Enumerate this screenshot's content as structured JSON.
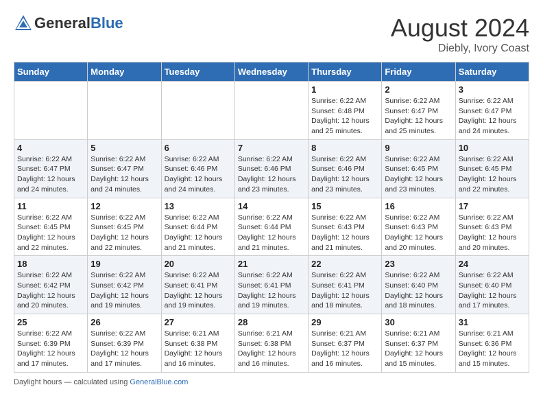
{
  "header": {
    "logo_general": "General",
    "logo_blue": "Blue",
    "month_year": "August 2024",
    "location": "Diebly, Ivory Coast"
  },
  "days_of_week": [
    "Sunday",
    "Monday",
    "Tuesday",
    "Wednesday",
    "Thursday",
    "Friday",
    "Saturday"
  ],
  "weeks": [
    [
      {
        "day": "",
        "info": ""
      },
      {
        "day": "",
        "info": ""
      },
      {
        "day": "",
        "info": ""
      },
      {
        "day": "",
        "info": ""
      },
      {
        "day": "1",
        "info": "Sunrise: 6:22 AM\nSunset: 6:48 PM\nDaylight: 12 hours\nand 25 minutes."
      },
      {
        "day": "2",
        "info": "Sunrise: 6:22 AM\nSunset: 6:47 PM\nDaylight: 12 hours\nand 25 minutes."
      },
      {
        "day": "3",
        "info": "Sunrise: 6:22 AM\nSunset: 6:47 PM\nDaylight: 12 hours\nand 24 minutes."
      }
    ],
    [
      {
        "day": "4",
        "info": "Sunrise: 6:22 AM\nSunset: 6:47 PM\nDaylight: 12 hours\nand 24 minutes."
      },
      {
        "day": "5",
        "info": "Sunrise: 6:22 AM\nSunset: 6:47 PM\nDaylight: 12 hours\nand 24 minutes."
      },
      {
        "day": "6",
        "info": "Sunrise: 6:22 AM\nSunset: 6:46 PM\nDaylight: 12 hours\nand 24 minutes."
      },
      {
        "day": "7",
        "info": "Sunrise: 6:22 AM\nSunset: 6:46 PM\nDaylight: 12 hours\nand 23 minutes."
      },
      {
        "day": "8",
        "info": "Sunrise: 6:22 AM\nSunset: 6:46 PM\nDaylight: 12 hours\nand 23 minutes."
      },
      {
        "day": "9",
        "info": "Sunrise: 6:22 AM\nSunset: 6:45 PM\nDaylight: 12 hours\nand 23 minutes."
      },
      {
        "day": "10",
        "info": "Sunrise: 6:22 AM\nSunset: 6:45 PM\nDaylight: 12 hours\nand 22 minutes."
      }
    ],
    [
      {
        "day": "11",
        "info": "Sunrise: 6:22 AM\nSunset: 6:45 PM\nDaylight: 12 hours\nand 22 minutes."
      },
      {
        "day": "12",
        "info": "Sunrise: 6:22 AM\nSunset: 6:45 PM\nDaylight: 12 hours\nand 22 minutes."
      },
      {
        "day": "13",
        "info": "Sunrise: 6:22 AM\nSunset: 6:44 PM\nDaylight: 12 hours\nand 21 minutes."
      },
      {
        "day": "14",
        "info": "Sunrise: 6:22 AM\nSunset: 6:44 PM\nDaylight: 12 hours\nand 21 minutes."
      },
      {
        "day": "15",
        "info": "Sunrise: 6:22 AM\nSunset: 6:43 PM\nDaylight: 12 hours\nand 21 minutes."
      },
      {
        "day": "16",
        "info": "Sunrise: 6:22 AM\nSunset: 6:43 PM\nDaylight: 12 hours\nand 20 minutes."
      },
      {
        "day": "17",
        "info": "Sunrise: 6:22 AM\nSunset: 6:43 PM\nDaylight: 12 hours\nand 20 minutes."
      }
    ],
    [
      {
        "day": "18",
        "info": "Sunrise: 6:22 AM\nSunset: 6:42 PM\nDaylight: 12 hours\nand 20 minutes."
      },
      {
        "day": "19",
        "info": "Sunrise: 6:22 AM\nSunset: 6:42 PM\nDaylight: 12 hours\nand 19 minutes."
      },
      {
        "day": "20",
        "info": "Sunrise: 6:22 AM\nSunset: 6:41 PM\nDaylight: 12 hours\nand 19 minutes."
      },
      {
        "day": "21",
        "info": "Sunrise: 6:22 AM\nSunset: 6:41 PM\nDaylight: 12 hours\nand 19 minutes."
      },
      {
        "day": "22",
        "info": "Sunrise: 6:22 AM\nSunset: 6:41 PM\nDaylight: 12 hours\nand 18 minutes."
      },
      {
        "day": "23",
        "info": "Sunrise: 6:22 AM\nSunset: 6:40 PM\nDaylight: 12 hours\nand 18 minutes."
      },
      {
        "day": "24",
        "info": "Sunrise: 6:22 AM\nSunset: 6:40 PM\nDaylight: 12 hours\nand 17 minutes."
      }
    ],
    [
      {
        "day": "25",
        "info": "Sunrise: 6:22 AM\nSunset: 6:39 PM\nDaylight: 12 hours\nand 17 minutes."
      },
      {
        "day": "26",
        "info": "Sunrise: 6:22 AM\nSunset: 6:39 PM\nDaylight: 12 hours\nand 17 minutes."
      },
      {
        "day": "27",
        "info": "Sunrise: 6:21 AM\nSunset: 6:38 PM\nDaylight: 12 hours\nand 16 minutes."
      },
      {
        "day": "28",
        "info": "Sunrise: 6:21 AM\nSunset: 6:38 PM\nDaylight: 12 hours\nand 16 minutes."
      },
      {
        "day": "29",
        "info": "Sunrise: 6:21 AM\nSunset: 6:37 PM\nDaylight: 12 hours\nand 16 minutes."
      },
      {
        "day": "30",
        "info": "Sunrise: 6:21 AM\nSunset: 6:37 PM\nDaylight: 12 hours\nand 15 minutes."
      },
      {
        "day": "31",
        "info": "Sunrise: 6:21 AM\nSunset: 6:36 PM\nDaylight: 12 hours\nand 15 minutes."
      }
    ]
  ],
  "footer": {
    "daylight_label": "Daylight hours"
  }
}
